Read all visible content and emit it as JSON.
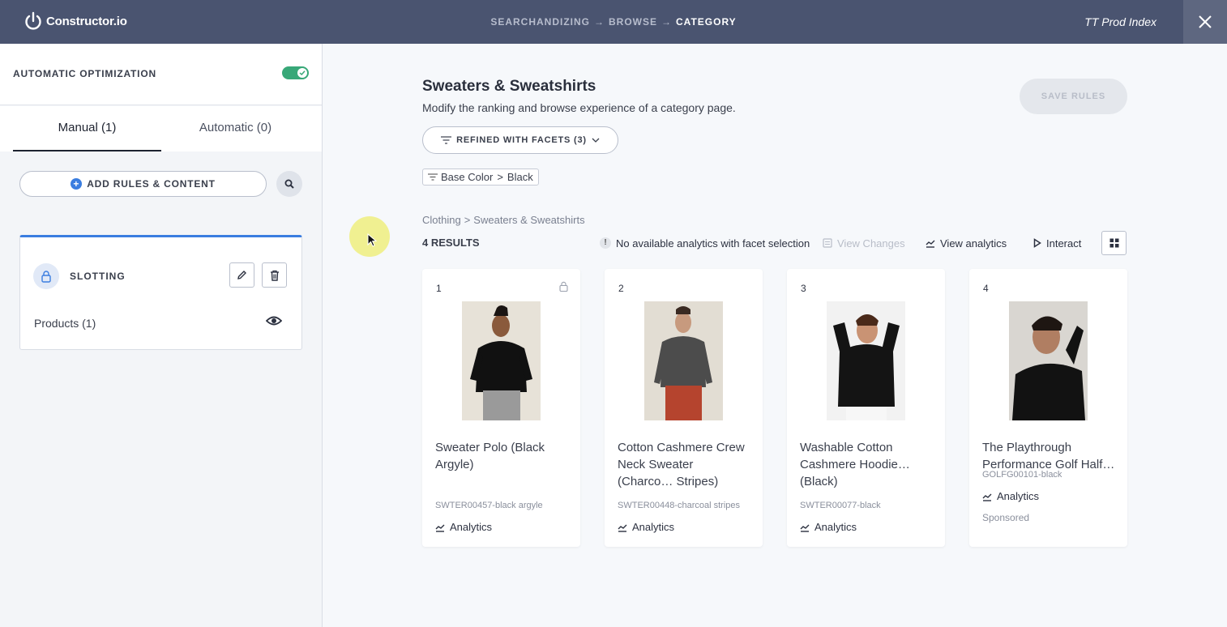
{
  "app": {
    "logo_text": "Constructor.io",
    "breadcrumb": [
      "SEARCHANDIZING",
      "BROWSE",
      "CATEGORY"
    ],
    "breadcrumb_arrow": "→",
    "index_name": "TT Prod Index"
  },
  "sidebar": {
    "auto_optimization_label": "AUTOMATIC OPTIMIZATION",
    "auto_optimization_on": true,
    "tabs": [
      {
        "label": "Manual (1)",
        "active": true
      },
      {
        "label": "Automatic (0)",
        "active": false
      }
    ],
    "add_rules_label": "ADD RULES & CONTENT",
    "slotting": {
      "title": "SLOTTING",
      "products_label": "Products (1)"
    }
  },
  "main": {
    "title": "Sweaters & Sweatshirts",
    "subtitle": "Modify the ranking and browse experience of a category page.",
    "save_rules_label": "SAVE RULES",
    "refined_label": "REFINED WITH FACETS (3)",
    "facet_chip": {
      "facet": "Base Color",
      "separator": ">",
      "value": "Black"
    },
    "breadcrumb": [
      "Clothing",
      "Sweaters & Sweatshirts"
    ],
    "breadcrumb_sep": ">",
    "results_label": "4 RESULTS",
    "analytics_note": "No available analytics with facet selection",
    "view_changes_label": "View Changes",
    "view_analytics_label": "View analytics",
    "interact_label": "Interact",
    "products": [
      {
        "rank": "1",
        "locked": true,
        "name": "Sweater Polo (Black Argyle)",
        "sku": "SWTER00457-black argyle",
        "analytics_label": "Analytics",
        "sponsored": ""
      },
      {
        "rank": "2",
        "locked": false,
        "name": "Cotton Cashmere Crew Neck Sweater (Charco… Stripes)",
        "sku": "SWTER00448-charcoal stripes",
        "analytics_label": "Analytics",
        "sponsored": ""
      },
      {
        "rank": "3",
        "locked": false,
        "name": "Washable Cotton Cashmere Hoodie… (Black)",
        "sku": "SWTER00077-black",
        "analytics_label": "Analytics",
        "sponsored": ""
      },
      {
        "rank": "4",
        "locked": false,
        "name": "The Playthrough Performance Golf Half…",
        "sku": "GOLFG00101-black",
        "analytics_label": "Analytics",
        "sponsored": "Sponsored"
      }
    ]
  },
  "colors": {
    "topbar": "#4a5470",
    "accent_blue": "#3a7de0",
    "toggle_green": "#38a878"
  }
}
